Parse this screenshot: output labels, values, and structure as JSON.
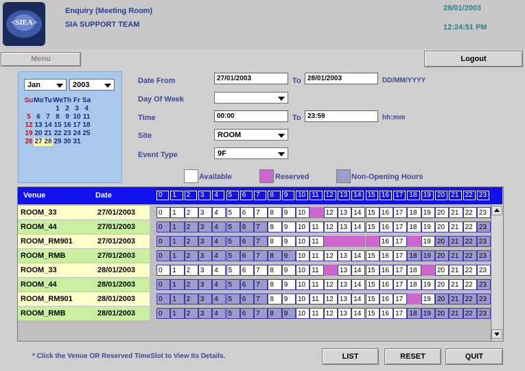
{
  "header": {
    "logo_text": "<SIEA>",
    "title": "Enquiry (Meeting Room)",
    "subtitle": "SIA SUPPORT TEAM",
    "date": "28/01/2003",
    "time": "12:24:51 PM"
  },
  "toolbar": {
    "menu_label": "Menu",
    "logout_label": "Logout"
  },
  "calendar": {
    "month": "Jan",
    "year": "2003",
    "weekdays": [
      "Su",
      "Mo",
      "Tu",
      "We",
      "Th",
      "Fr",
      "Sa"
    ],
    "weeks": [
      [
        "",
        "",
        "",
        "1",
        "2",
        "3",
        "4"
      ],
      [
        "5",
        "6",
        "7",
        "8",
        "9",
        "10",
        "11"
      ],
      [
        "12",
        "13",
        "14",
        "15",
        "16",
        "17",
        "18"
      ],
      [
        "19",
        "20",
        "21",
        "22",
        "23",
        "24",
        "25"
      ],
      [
        "26",
        "27",
        "28",
        "29",
        "30",
        "31",
        ""
      ]
    ],
    "selected": [
      "27",
      "28"
    ]
  },
  "form": {
    "date_from_label": "Date From",
    "date_from_value": "27/01/2003",
    "to_label": "To",
    "date_to_value": "28/01/2003",
    "date_format": "DD/MM/YYYY",
    "day_of_week_label": "Day Of Week",
    "day_of_week_value": "",
    "time_label": "Time",
    "time_from_value": "00:00",
    "time_to_value": "23:59",
    "time_format": "hh:mm",
    "site_label": "Site",
    "site_value": "ROOM",
    "event_type_label": "Event Type",
    "event_type_value": "9F"
  },
  "legend": {
    "available": "Available",
    "reserved": "Reserved",
    "non_opening": "Non-Opening Hours",
    "colors": {
      "available": "#ffffff",
      "reserved": "#cc66cc",
      "non_opening": "#9b9bd0"
    }
  },
  "table": {
    "venue_header": "Venue",
    "date_header": "Date",
    "hours": [
      "0",
      "1",
      "2",
      "3",
      "4",
      "5",
      "6",
      "7",
      "8",
      "9",
      "10",
      "11",
      "12",
      "13",
      "14",
      "15",
      "16",
      "17",
      "18",
      "19",
      "20",
      "21",
      "22",
      "23"
    ],
    "rows": [
      {
        "venue": "ROOM_33",
        "date": "27/01/2003",
        "bg": "#ffffcc",
        "slots": "AAAAAAAAAAARAAAAAAAAAAAA"
      },
      {
        "venue": "ROOM_44",
        "date": "27/01/2003",
        "bg": "#c8f0a0",
        "slots": "NNNNNNNNAAAAAAAAAAAAAAAN"
      },
      {
        "venue": "ROOM_RM901",
        "date": "27/01/2003",
        "bg": "#ffffcc",
        "slots": "NNNNNNNNAAAARRRRAARANNNN"
      },
      {
        "venue": "ROOM_RMB",
        "date": "27/01/2003",
        "bg": "#c8f0a0",
        "slots": "NNNNNNNNNNAAAAAAAANNNNNN"
      },
      {
        "venue": "ROOM_33",
        "date": "28/01/2003",
        "bg": "#ffffcc",
        "slots": "AAAAAAAAAAAARAAAAAARAAAA"
      },
      {
        "venue": "ROOM_44",
        "date": "28/01/2003",
        "bg": "#c8f0a0",
        "slots": "NNNNNNNNAAAAAAAAAAAAAAAN"
      },
      {
        "venue": "ROOM_RM901",
        "date": "28/01/2003",
        "bg": "#ffffcc",
        "slots": "NNNNNNNNAAAAAAAAAARANNNN"
      },
      {
        "venue": "ROOM_RMB",
        "date": "28/01/2003",
        "bg": "#c8f0a0",
        "slots": "NNNNNNNNNNAAAAAAAANNNNNN"
      }
    ]
  },
  "footer": {
    "note": "* Click the Venue OR Reserved TimeSlot to View Its Details.",
    "list_label": "LIST",
    "reset_label": "RESET",
    "quit_label": "QUIT"
  }
}
